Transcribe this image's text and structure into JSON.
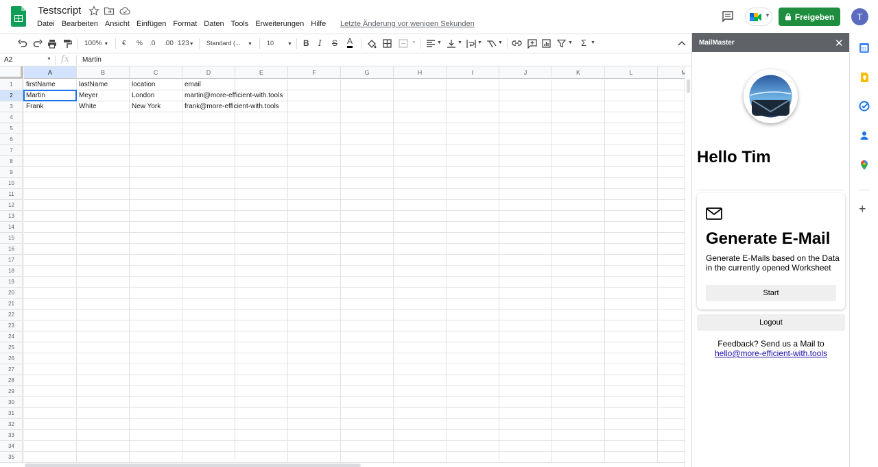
{
  "app": {
    "doc_title": "Testscript",
    "menu": [
      "Datei",
      "Bearbeiten",
      "Ansicht",
      "Einfügen",
      "Format",
      "Daten",
      "Tools",
      "Erweiterungen",
      "Hilfe"
    ],
    "last_edit": "Letzte Änderung vor wenigen Sekunden",
    "share_label": "Freigeben",
    "avatar_letter": "T",
    "brand_color": "#1e8e3e"
  },
  "toolbar": {
    "zoom": "100%",
    "currency": "€",
    "percent": "%",
    "dec_less": ".0",
    "dec_more": ".00",
    "more_formats": "123",
    "font": "Standard (...",
    "font_size": "10"
  },
  "formula": {
    "cell_ref": "A2",
    "fx": "fx",
    "value": "Martin"
  },
  "sheet": {
    "columns": [
      "A",
      "B",
      "C",
      "D",
      "E",
      "F",
      "G",
      "H",
      "I",
      "J",
      "K",
      "L",
      "M"
    ],
    "row_numbers": [
      "1",
      "2",
      "3",
      "4",
      "5",
      "6",
      "7",
      "8",
      "9",
      "10",
      "11",
      "12",
      "13",
      "14",
      "15",
      "16",
      "17",
      "18",
      "19",
      "20",
      "21",
      "22",
      "23",
      "24",
      "25",
      "26",
      "27",
      "28",
      "29",
      "30",
      "31",
      "32",
      "33",
      "34",
      "35"
    ],
    "rows": [
      [
        "firstName",
        "lastName",
        "location",
        "email"
      ],
      [
        "Martin",
        "Meyer",
        "London",
        "martin@more-efficient-with.tools"
      ],
      [
        "Frank",
        "White",
        "New York",
        "frank@more-efficient-with.tools"
      ]
    ]
  },
  "panel": {
    "title": "MailMaster",
    "greeting": "Hello Tim",
    "card_title": "Generate E-Mail",
    "card_desc": "Generate E-Mails based on the Data in the currently opened Worksheet",
    "start_label": "Start",
    "logout_label": "Logout",
    "feedback_text": "Feedback? Send us a Mail to",
    "feedback_email": "hello@more-efficient-with.tools"
  },
  "icons": [
    "sheets-logo-icon",
    "star-icon",
    "move-folder-icon",
    "cloud-icon",
    "comment-icon",
    "meet-icon",
    "lock-icon",
    "undo-icon",
    "redo-icon",
    "print-icon",
    "paint-format-icon",
    "bold-icon",
    "italic-icon",
    "strikethrough-icon",
    "text-color-icon",
    "fill-color-icon",
    "borders-icon",
    "merge-icon",
    "align-icon",
    "valign-icon",
    "wrap-icon",
    "rotate-icon",
    "link-icon",
    "insert-comment-icon",
    "chart-icon",
    "filter-icon",
    "functions-icon",
    "collapse-icon",
    "close-icon",
    "envelope-icon",
    "calendar-icon",
    "keep-icon",
    "tasks-icon",
    "contacts-icon",
    "maps-icon",
    "plus-icon"
  ]
}
